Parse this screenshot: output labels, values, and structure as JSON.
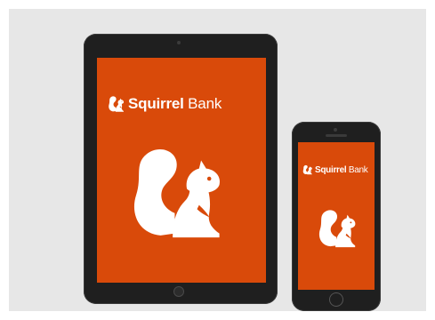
{
  "brand": {
    "name_part1": "Squirrel",
    "name_part2": "Bank",
    "logo_icon": "squirrel-icon"
  },
  "colors": {
    "background": "#e7e7e7",
    "screen": "#d94a0a",
    "device_body": "#1f1f1f",
    "logo": "#ffffff"
  },
  "devices": [
    "tablet",
    "phone"
  ]
}
